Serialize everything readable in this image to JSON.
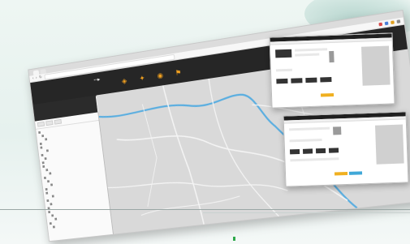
{
  "browser": {
    "tabs": [
      "",
      ""
    ],
    "url": "",
    "nav_back": "‹",
    "nav_forward": "›",
    "nav_reload": "↻",
    "extension_colors": [
      "#d94a4a",
      "#4a7fd9",
      "#e0a020",
      "#888888"
    ]
  },
  "app": {
    "logo": "⋯▸",
    "title": "",
    "user_info": "",
    "toolbar": [
      {
        "icon": "layers-icon",
        "glyph": "◈",
        "label": ""
      },
      {
        "icon": "tool-icon",
        "glyph": "✦",
        "label": ""
      },
      {
        "icon": "search-icon",
        "glyph": "◉",
        "label": ""
      },
      {
        "icon": "flag-icon",
        "glyph": "⚑",
        "label": ""
      }
    ],
    "subheader_lines": [
      "",
      ""
    ]
  },
  "sidebar": {
    "tree": [
      "",
      "",
      "",
      "",
      "",
      "",
      "",
      "",
      "",
      "",
      "",
      "",
      "",
      "",
      "",
      "",
      "",
      "",
      "",
      "",
      "",
      "",
      "",
      "",
      "",
      ""
    ],
    "footer": ""
  },
  "colors": {
    "toolbar_bg": "#262626",
    "accent": "#f0a020",
    "river": "#5aaee0",
    "map_bg": "#d9d9d9",
    "roads": "#f4f4f4",
    "button_orange": "#f0b020",
    "button_blue": "#40a8d8",
    "brand_green": "#2ea84b"
  }
}
